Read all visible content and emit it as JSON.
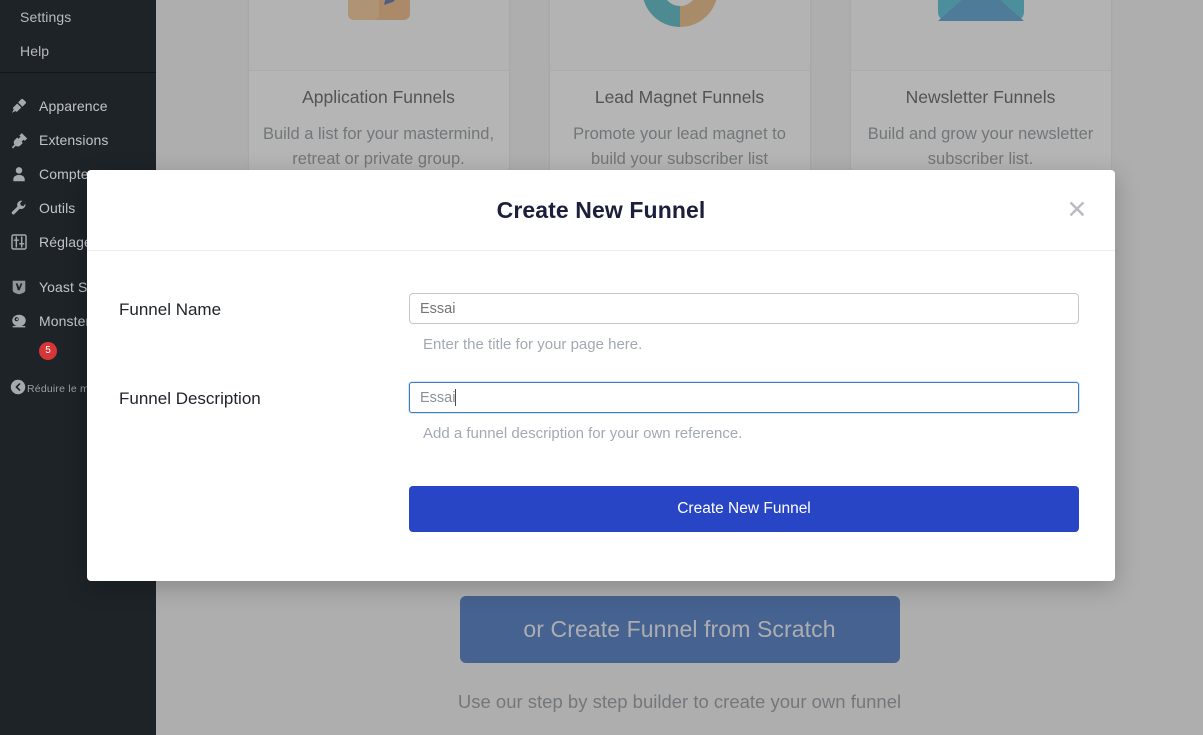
{
  "sidebar": {
    "top_items": [
      {
        "label": "Settings",
        "icon": "settings-icon"
      },
      {
        "label": "Help",
        "icon": "help-icon"
      }
    ],
    "menu_items": [
      {
        "label": "Apparence",
        "icon": "paintbrush-icon"
      },
      {
        "label": "Extensions",
        "icon": "plug-icon"
      },
      {
        "label": "Comptes",
        "icon": "user-icon"
      },
      {
        "label": "Outils",
        "icon": "wrench-icon"
      },
      {
        "label": "Réglages",
        "icon": "sliders-icon"
      }
    ],
    "plugin_items": [
      {
        "label": "Yoast SE",
        "icon": "yoast-icon",
        "badge": null
      },
      {
        "label": "Monster",
        "icon": "monsterinsights-icon",
        "badge": "5"
      }
    ],
    "collapse": {
      "label": "Réduire le m",
      "icon": "collapse-arrow-icon"
    }
  },
  "content": {
    "cards": [
      {
        "title": "Application Funnels",
        "description": "Build a list for your mastermind, retreat or private group.",
        "icon": "signature-document-icon"
      },
      {
        "title": "Lead Magnet Funnels",
        "description": "Promote your lead magnet to build your subscriber list",
        "icon": "donut-chart-icon"
      },
      {
        "title": "Newsletter Funnels",
        "description": "Build and grow your newsletter subscriber list.",
        "icon": "envelope-icon"
      }
    ],
    "scratch_button_label": "or Create Funnel from Scratch",
    "scratch_caption": "Use our step by step builder to create your own funnel"
  },
  "modal": {
    "title": "Create New Funnel",
    "close_icon": "close-icon",
    "fields": [
      {
        "label": "Funnel Name",
        "value": "Essai",
        "placeholder": "Essai",
        "hint": "Enter the title for your page here.",
        "focused": false
      },
      {
        "label": "Funnel Description",
        "value": "Essai",
        "placeholder": "Essai",
        "hint": "Add a funnel description for your own reference.",
        "focused": true
      }
    ],
    "submit_label": "Create New Funnel"
  },
  "colors": {
    "sidebar_bg": "#1d2327",
    "primary_button": "#2845c6",
    "scratch_button": "#0a47ad",
    "badge": "#d63638",
    "focus_border": "#3b7cc4"
  }
}
